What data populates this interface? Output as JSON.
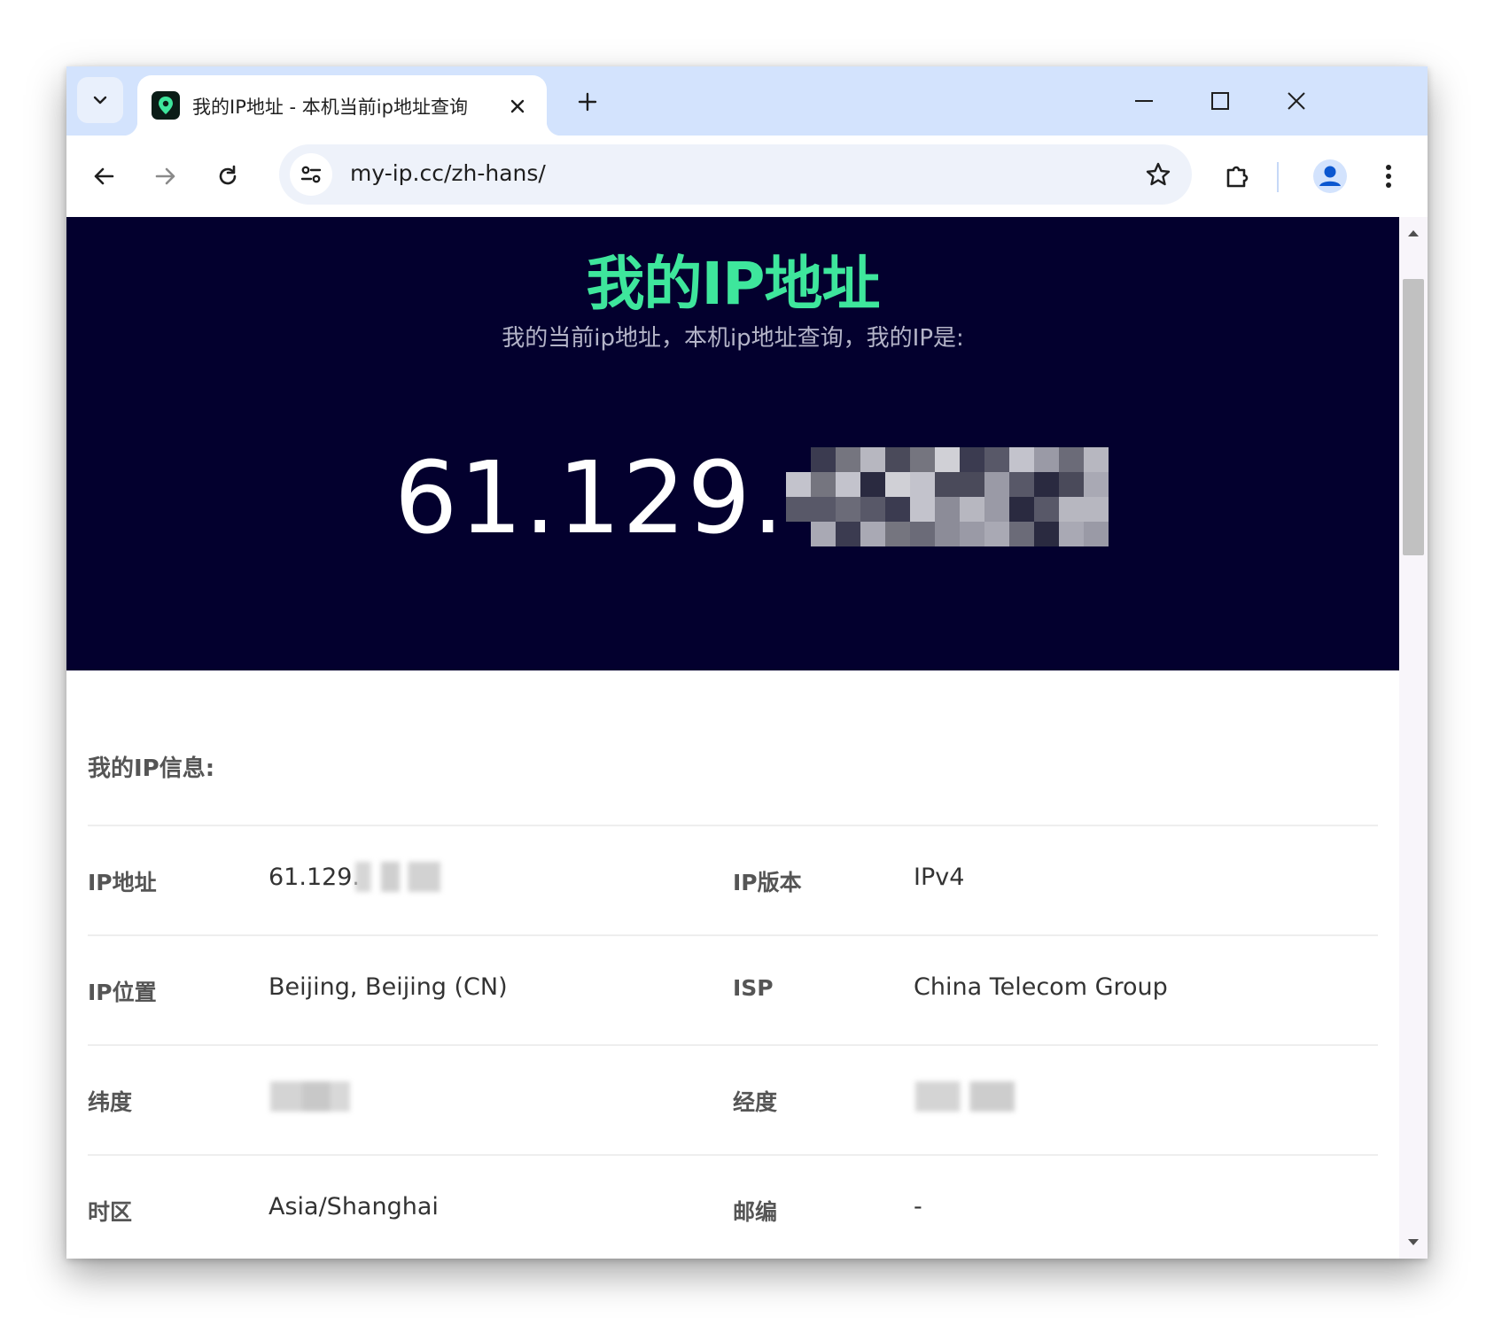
{
  "browser": {
    "tab_title": "我的IP地址 - 本机当前ip地址查询",
    "url": "my-ip.cc/zh-hans/"
  },
  "hero": {
    "title": "我的IP地址",
    "subtitle": "我的当前ip地址，本机ip地址查询，我的IP是:",
    "ip_visible_prefix": "61.129."
  },
  "info": {
    "heading": "我的IP信息:",
    "rows": [
      {
        "left_label": "IP地址",
        "left_value": "61.129.",
        "right_label": "IP版本",
        "right_value": "IPv4"
      },
      {
        "left_label": "IP位置",
        "left_value": "Beijing, Beijing (CN)",
        "right_label": "ISP",
        "right_value": "China Telecom Group"
      },
      {
        "left_label": "纬度",
        "left_value": "",
        "right_label": "经度",
        "right_value": ""
      },
      {
        "left_label": "时区",
        "left_value": "Asia/Shanghai",
        "right_label": "邮编",
        "right_value": "-"
      }
    ]
  },
  "colors": {
    "tabbar": "#d3e3fd",
    "hero_bg": "#03002e",
    "hero_title": "#3ee69c",
    "favicon_bg": "#0b1d17",
    "avatar": "#0b57d0"
  },
  "icons": {
    "tab_list": "chevron-down-icon",
    "tab_close": "close-icon",
    "new_tab": "plus-icon",
    "back": "arrow-left-icon",
    "forward": "arrow-right-icon",
    "reload": "reload-icon",
    "site_info": "tune-icon",
    "bookmark": "star-icon",
    "extensions": "puzzle-icon",
    "profile": "person-icon",
    "menu": "kebab-icon"
  }
}
